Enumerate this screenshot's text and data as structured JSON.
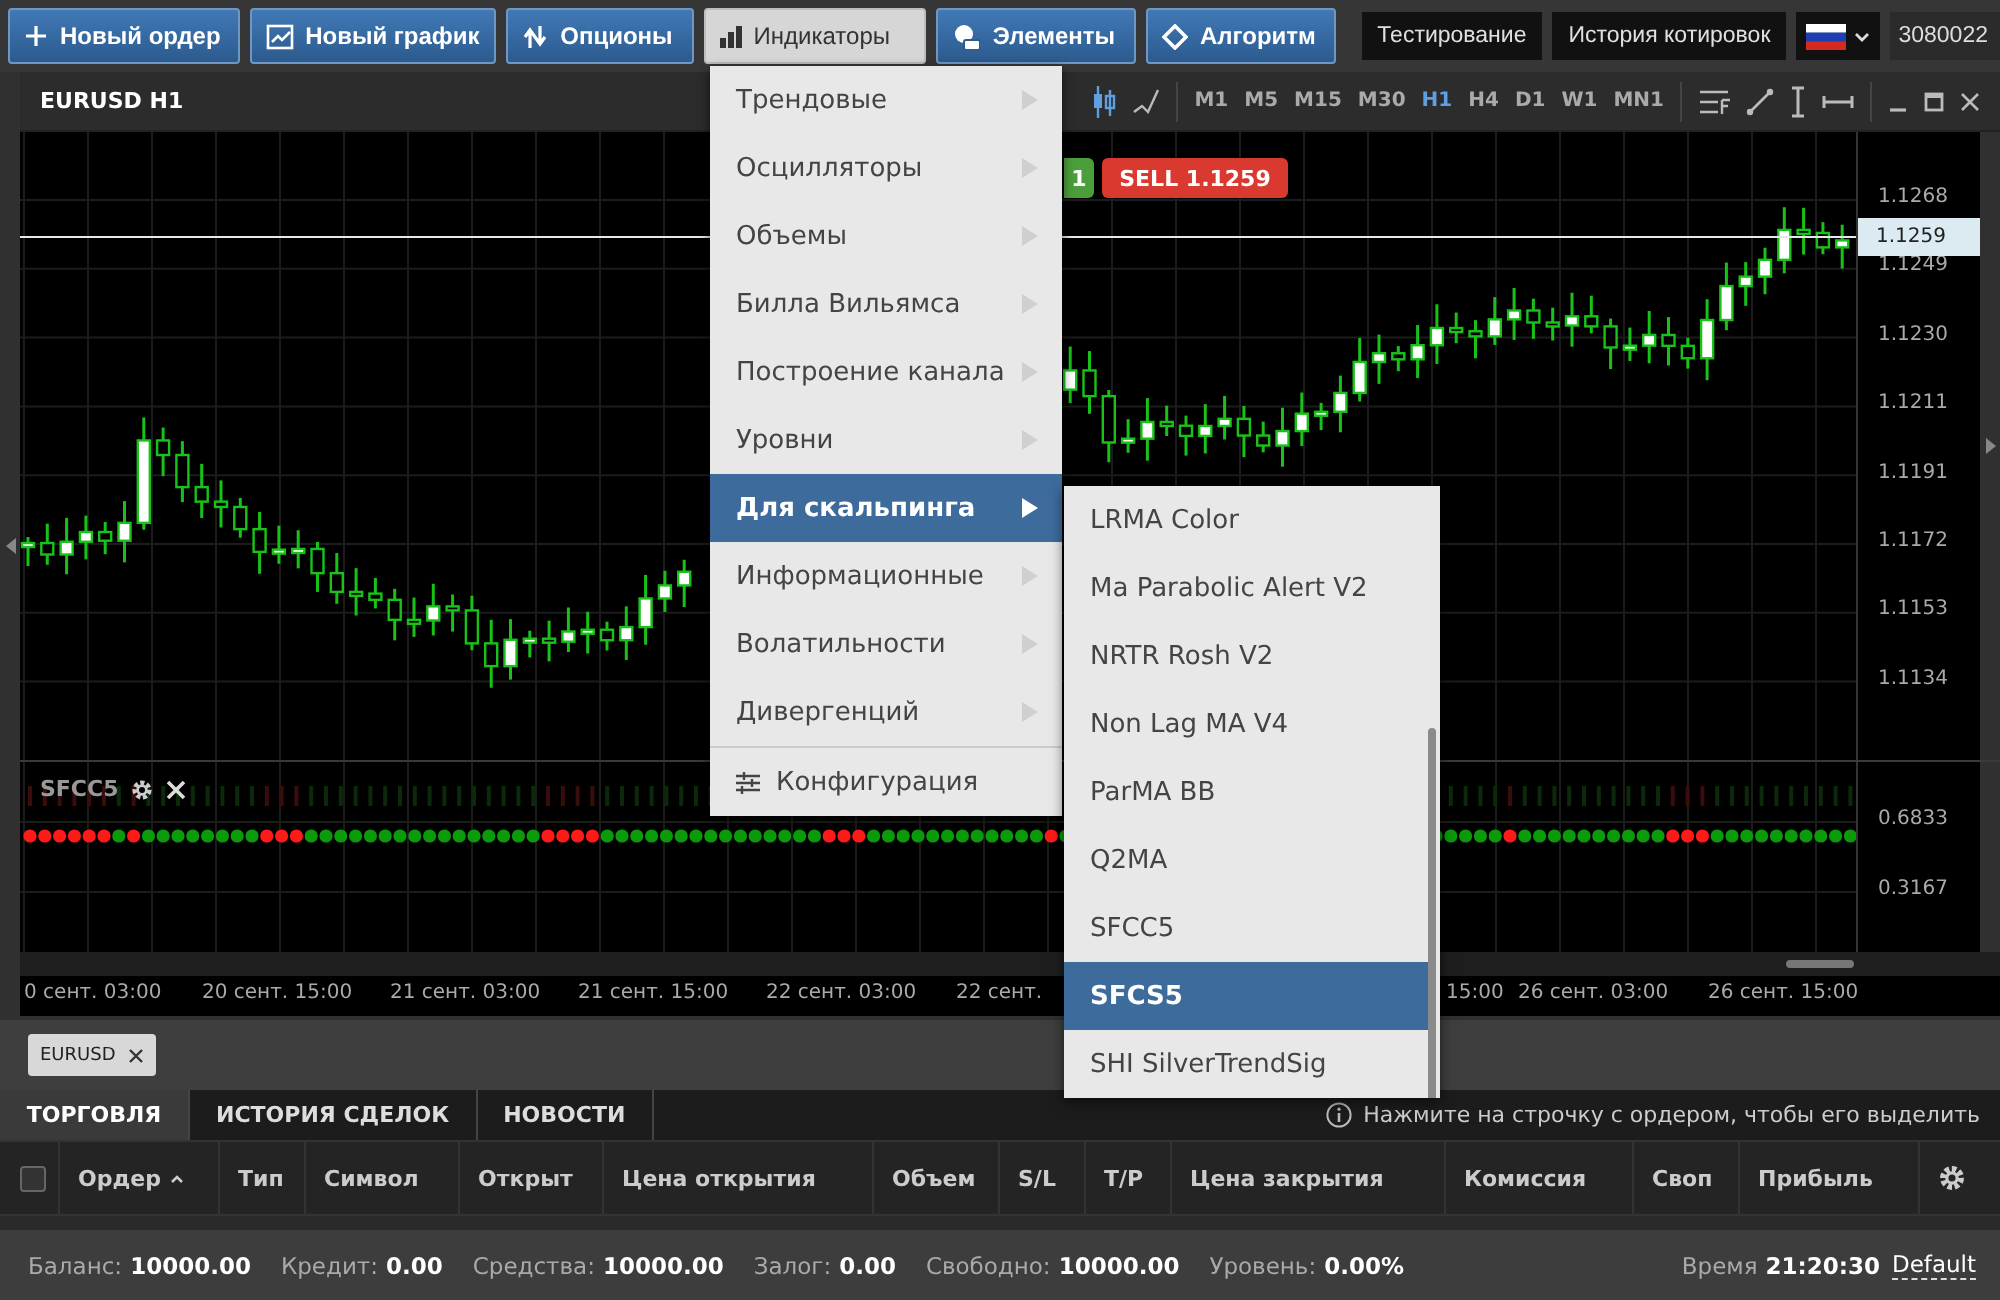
{
  "toolbar": {
    "buttons": [
      {
        "label": "Новый ордер",
        "selected": false
      },
      {
        "label": "Новый график",
        "selected": false
      },
      {
        "label": "Опционы",
        "selected": false
      },
      {
        "label": "Индикаторы",
        "selected": true
      },
      {
        "label": "Элементы",
        "selected": false
      },
      {
        "label": "Алгоритм",
        "selected": false
      }
    ],
    "right_buttons": [
      "Тестирование",
      "История котировок"
    ],
    "account": "3080022"
  },
  "chart": {
    "title": "EURUSD H1",
    "timeframes": [
      {
        "label": "M1",
        "selected": false
      },
      {
        "label": "M5",
        "selected": false
      },
      {
        "label": "M15",
        "selected": false
      },
      {
        "label": "M30",
        "selected": false
      },
      {
        "label": "H1",
        "selected": true
      },
      {
        "label": "H4",
        "selected": false
      },
      {
        "label": "D1",
        "selected": false
      },
      {
        "label": "W1",
        "selected": false
      },
      {
        "label": "MN1",
        "selected": false
      }
    ],
    "trade_buttons": [
      {
        "kind": "buy",
        "label": "1"
      },
      {
        "kind": "sell",
        "label": "SELL 1.1259"
      }
    ],
    "price_labels": [
      "1.1268",
      "1.1249",
      "1.1230",
      "1.1211",
      "1.1191",
      "1.1172",
      "1.1153",
      "1.1134"
    ],
    "current_price": "1.1259",
    "indicator": {
      "name": "SFCC5",
      "levels": [
        "0.6833",
        "0.3167"
      ]
    },
    "time_labels": [
      "0 сент. 03:00",
      "20 сент. 15:00",
      "21 сент. 03:00",
      "21 сент. 15:00",
      "22 сент. 03:00",
      "22 сент.",
      "15:00",
      "26 сент. 03:00",
      "26 сент. 15:00"
    ]
  },
  "indicators_menu": {
    "items": [
      {
        "label": "Трендовые",
        "selected": false
      },
      {
        "label": "Осцилляторы",
        "selected": false
      },
      {
        "label": "Объемы",
        "selected": false
      },
      {
        "label": "Билла Вильямса",
        "selected": false
      },
      {
        "label": "Построение канала",
        "selected": false
      },
      {
        "label": "Уровни",
        "selected": false
      },
      {
        "label": "Для скальпинга",
        "selected": true
      },
      {
        "label": "Информационные",
        "selected": false
      },
      {
        "label": "Волатильности",
        "selected": false
      },
      {
        "label": "Дивергенций",
        "selected": false
      }
    ],
    "footer": "Конфигурация"
  },
  "submenu": {
    "items": [
      {
        "label": "LRMA Color",
        "selected": false
      },
      {
        "label": "Ma Parabolic Alert V2",
        "selected": false
      },
      {
        "label": "NRTR Rosh V2",
        "selected": false
      },
      {
        "label": "Non Lag MA V4",
        "selected": false
      },
      {
        "label": "ParMA BB",
        "selected": false
      },
      {
        "label": "Q2MA",
        "selected": false
      },
      {
        "label": "SFCC5",
        "selected": false
      },
      {
        "label": "SFCS5",
        "selected": true
      },
      {
        "label": "SHI SilverTrendSig",
        "selected": false
      }
    ]
  },
  "symbol_tabs": [
    {
      "label": "EURUSD"
    }
  ],
  "panel": {
    "tabs": [
      {
        "label": "ТОРГОВЛЯ",
        "selected": true
      },
      {
        "label": "ИСТОРИЯ СДЕЛОК",
        "selected": false
      },
      {
        "label": "НОВОСТИ",
        "selected": false
      }
    ],
    "hint": "Нажмите на строчку с ордером, чтобы его выделить",
    "select_all": {
      "checked": false
    },
    "columns": [
      {
        "label": "Ордер",
        "sorted": true
      },
      {
        "label": "Тип",
        "sorted": false
      },
      {
        "label": "Символ",
        "sorted": false
      },
      {
        "label": "Открыт",
        "sorted": false
      },
      {
        "label": "Цена открытия",
        "sorted": false
      },
      {
        "label": "Объем",
        "sorted": false
      },
      {
        "label": "S/L",
        "sorted": false
      },
      {
        "label": "T/P",
        "sorted": false
      },
      {
        "label": "Цена закрытия",
        "sorted": false
      },
      {
        "label": "Комиссия",
        "sorted": false
      },
      {
        "label": "Своп",
        "sorted": false
      },
      {
        "label": "Прибыль",
        "sorted": false
      }
    ]
  },
  "status_bar": {
    "items": [
      {
        "label": "Баланс:",
        "value": "10000.00"
      },
      {
        "label": "Кредит:",
        "value": "0.00"
      },
      {
        "label": "Средства:",
        "value": "10000.00"
      },
      {
        "label": "Залог:",
        "value": "0.00"
      },
      {
        "label": "Свободно:",
        "value": "10000.00"
      },
      {
        "label": "Уровень:",
        "value": "0.00%"
      }
    ],
    "time_label": "Время",
    "time": "21:20:30",
    "profile": "Default"
  }
}
